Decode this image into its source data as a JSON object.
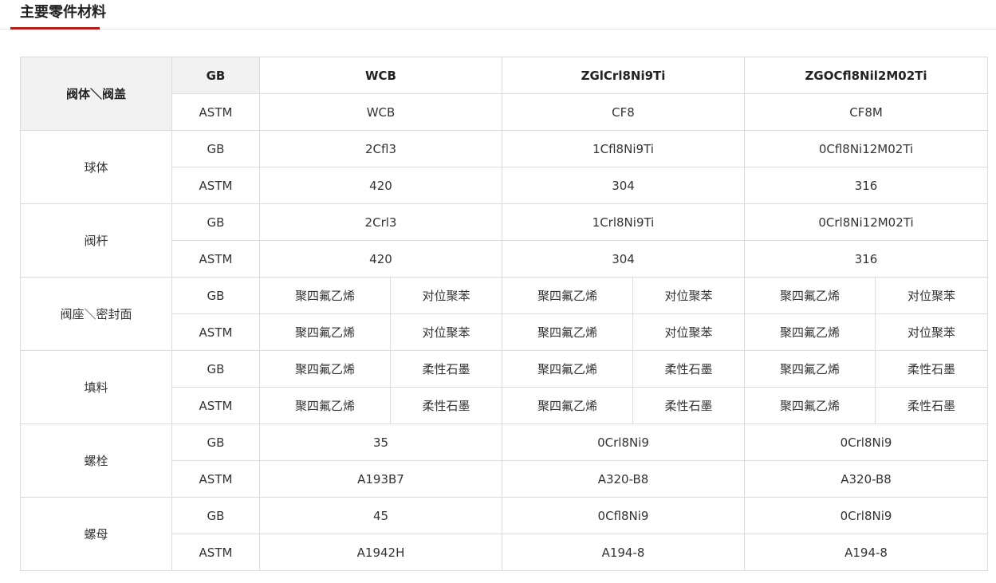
{
  "section": {
    "title": "主要零件材料"
  },
  "table": {
    "header": {
      "part_label": "阀体＼阀盖",
      "gb": {
        "std": "GB",
        "values": [
          "WCB",
          "ZGlCrl8Ni9Ti",
          "ZGOCfl8Nil2M02Ti"
        ]
      },
      "astm": {
        "std": "ASTM",
        "values": [
          "WCB",
          "CF8",
          "CF8M"
        ]
      }
    },
    "ball": {
      "label": "球体",
      "gb": {
        "std": "GB",
        "values": [
          "2Cfl3",
          "1Cfl8Ni9Ti",
          "0Cfl8Ni12M02Ti"
        ]
      },
      "astm": {
        "std": "ASTM",
        "values": [
          "420",
          "304",
          "316"
        ]
      }
    },
    "stem": {
      "label": "阀杆",
      "gb": {
        "std": "GB",
        "values": [
          "2Crl3",
          "1Crl8Ni9Ti",
          "0Crl8Ni12M02Ti"
        ]
      },
      "astm": {
        "std": "ASTM",
        "values": [
          "420",
          "304",
          "316"
        ]
      }
    },
    "seat": {
      "label": "阀座＼密封面",
      "gb": {
        "std": "GB",
        "values": [
          "聚四氟乙烯",
          "对位聚苯",
          "聚四氟乙烯",
          "对位聚苯",
          "聚四氟乙烯",
          "对位聚苯"
        ]
      },
      "astm": {
        "std": "ASTM",
        "values": [
          "聚四氟乙烯",
          "对位聚苯",
          "聚四氟乙烯",
          "对位聚苯",
          "聚四氟乙烯",
          "对位聚苯"
        ]
      }
    },
    "packing": {
      "label": "填料",
      "gb": {
        "std": "GB",
        "values": [
          "聚四氟乙烯",
          "柔性石墨",
          "聚四氟乙烯",
          "柔性石墨",
          "聚四氟乙烯",
          "柔性石墨"
        ]
      },
      "astm": {
        "std": "ASTM",
        "values": [
          "聚四氟乙烯",
          "柔性石墨",
          "聚四氟乙烯",
          "柔性石墨",
          "聚四氟乙烯",
          "柔性石墨"
        ]
      }
    },
    "bolt": {
      "label": "螺栓",
      "gb": {
        "std": "GB",
        "values": [
          "35",
          "0Crl8Ni9",
          "0Crl8Ni9"
        ]
      },
      "astm": {
        "std": "ASTM",
        "values": [
          "A193B7",
          "A320-B8",
          "A320-B8"
        ]
      }
    },
    "nut": {
      "label": "螺母",
      "gb": {
        "std": "GB",
        "values": [
          "45",
          "0Cfl8Ni9",
          "0Crl8Ni9"
        ]
      },
      "astm": {
        "std": "ASTM",
        "values": [
          "A1942H",
          "A194-8",
          "A194-8"
        ]
      }
    }
  }
}
